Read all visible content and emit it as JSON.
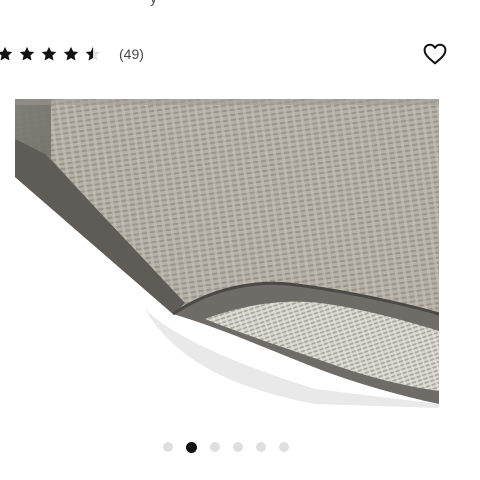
{
  "header": {
    "cut_text": "y"
  },
  "rating": {
    "value": 4.5,
    "max": 5,
    "count_label": "(49)"
  },
  "wishlist": {
    "icon": "heart-outline-icon"
  },
  "image": {
    "subject": "rug-corner-folded",
    "colors": {
      "weave": "#b4b0a6",
      "border": "#6f6c67"
    }
  },
  "carousel": {
    "total": 6,
    "active_index": 1
  }
}
